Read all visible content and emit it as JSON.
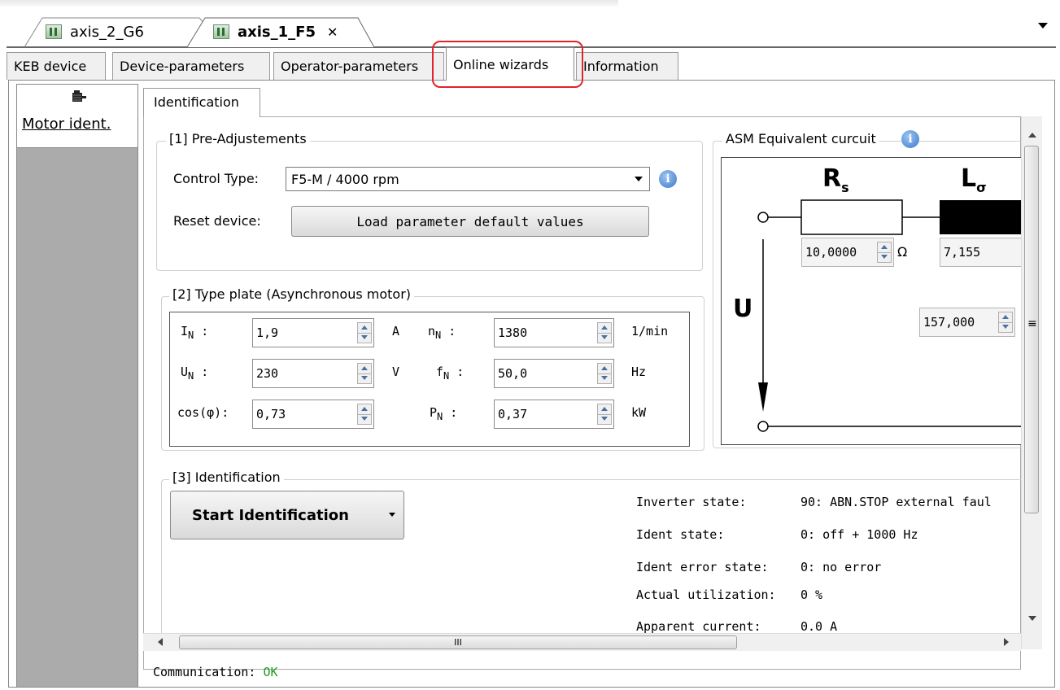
{
  "doc_tabs": [
    {
      "label": "axis_2_G6",
      "active": false
    },
    {
      "label": "axis_1_F5",
      "active": true,
      "close": "✕"
    }
  ],
  "page_tabs": [
    "KEB device",
    "Device-parameters",
    "Operator-parameters",
    "Online wizards",
    "Information"
  ],
  "active_page_tab": "Online wizards",
  "left_nav": {
    "item": "Motor ident.",
    "icon": "motor-icon"
  },
  "sub_tab": "Identification",
  "pre_adjustments": {
    "title": "[1] Pre-Adjustements",
    "control_type_label": "Control Type:",
    "control_type_value": "F5-M / 4000 rpm",
    "reset_label": "Reset device:",
    "reset_button": "Load parameter default values"
  },
  "type_plate": {
    "title": "[2] Type plate (Asynchronous motor)",
    "rows": [
      {
        "l1": "I",
        "s1": "N",
        "sep1": " :",
        "v1": "1,9",
        "u1": "A",
        "l2": "n",
        "s2": "N",
        "sep2": " :",
        "v2": "1380",
        "u2": "1/min"
      },
      {
        "l1": "U",
        "s1": "N",
        "sep1": " :",
        "v1": "230",
        "u1": "V",
        "l2": "f",
        "s2": "N",
        "sep2": " :",
        "v2": "50,0",
        "u2": "Hz"
      },
      {
        "l1": "cos(φ)",
        "s1": "",
        "sep1": ":",
        "v1": "0,73",
        "u1": "",
        "l2": "P",
        "s2": "N",
        "sep2": " :",
        "v2": "0,37",
        "u2": "kW"
      }
    ]
  },
  "circuit": {
    "title": "ASM Equivalent curcuit",
    "rs_label": "R",
    "rs_sub": "s",
    "ls_label": "L",
    "ls_sub": "σ",
    "u_label": "U",
    "rs_value": "10,0000",
    "rs_unit": "Ω",
    "ls_value": "7,155",
    "mid_value": "157,000"
  },
  "identification": {
    "title": "[3] Identification",
    "start_button": "Start Identification",
    "status": [
      {
        "label": "Inverter state:",
        "value": "90: ABN.STOP external faul"
      },
      {
        "label": "Ident state:",
        "value": "0: off + 1000 Hz"
      },
      {
        "label": "Ident error state:",
        "value": "0: no error"
      },
      {
        "label": "Actual utilization:",
        "value": "0 %"
      },
      {
        "label": "Apparent current:",
        "value": "0.0 A"
      }
    ]
  },
  "scroll": {
    "hthumb_grip": "III",
    "vthumb_grip": "≡"
  },
  "communication": {
    "label": "Communication:",
    "value": "OK",
    "value_color": "#1f9a1f"
  }
}
